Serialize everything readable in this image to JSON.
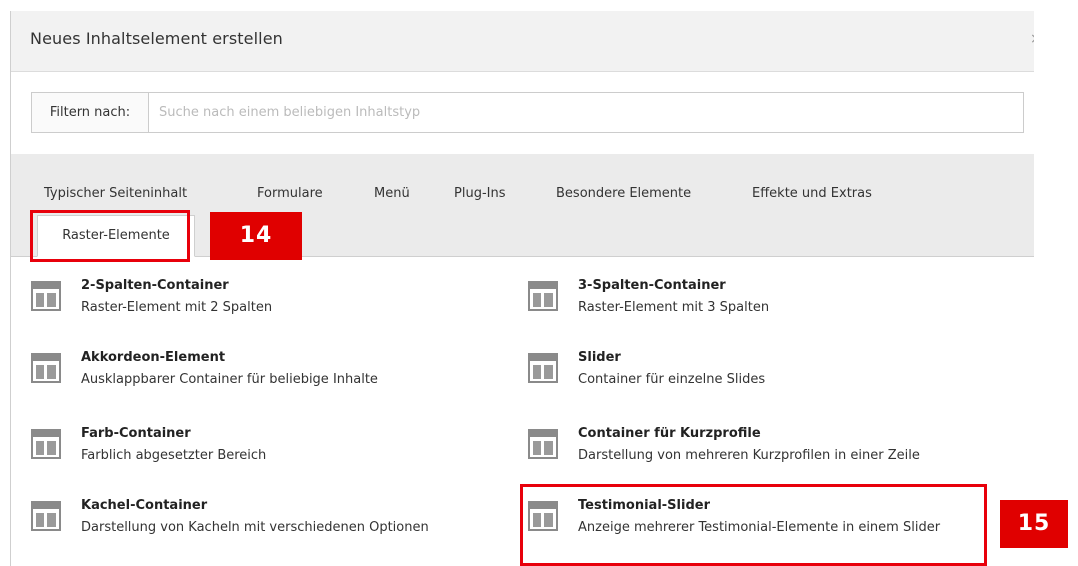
{
  "dialog": {
    "title": "Neues Inhaltselement erstellen"
  },
  "filter": {
    "label": "Filtern nach:",
    "placeholder": "Suche nach einem beliebigen Inhaltstyp",
    "value": ""
  },
  "tabs": [
    {
      "label": "Typischer Seiteninhalt"
    },
    {
      "label": "Formulare"
    },
    {
      "label": "Menü"
    },
    {
      "label": "Plug-Ins"
    },
    {
      "label": "Besondere Elemente"
    },
    {
      "label": "Effekte und Extras"
    },
    {
      "label": "Raster-Elemente"
    }
  ],
  "active_tab": "Raster-Elemente",
  "callouts": [
    "14",
    "15"
  ],
  "elements": [
    {
      "title": "2-Spalten-Container",
      "desc": "Raster-Element mit 2 Spalten",
      "icon": "grid-layout-icon"
    },
    {
      "title": "3-Spalten-Container",
      "desc": "Raster-Element mit 3 Spalten",
      "icon": "grid-layout-icon"
    },
    {
      "title": "Akkordeon-Element",
      "desc": "Ausklappbarer Container für beliebige Inhalte",
      "icon": "grid-layout-icon"
    },
    {
      "title": "Slider",
      "desc": "Container für einzelne Slides",
      "icon": "grid-layout-icon"
    },
    {
      "title": "Farb-Container",
      "desc": "Farblich abgesetzter Bereich",
      "icon": "grid-layout-icon"
    },
    {
      "title": "Container für Kurzprofile",
      "desc": "Darstellung von mehreren Kurzprofilen in einer Zeile",
      "icon": "grid-layout-icon"
    },
    {
      "title": "Kachel-Container",
      "desc": "Darstellung von Kacheln mit verschiedenen Optionen",
      "icon": "grid-layout-icon"
    },
    {
      "title": "Testimonial-Slider",
      "desc": "Anzeige mehrerer Testimonial-Elemente in einem Slider",
      "icon": "grid-layout-icon"
    }
  ],
  "colors": {
    "highlight": "#e8000b",
    "callout_bg": "#e00000",
    "tabs_bg": "#ebebeb",
    "header_bg": "#f2f2f2"
  }
}
